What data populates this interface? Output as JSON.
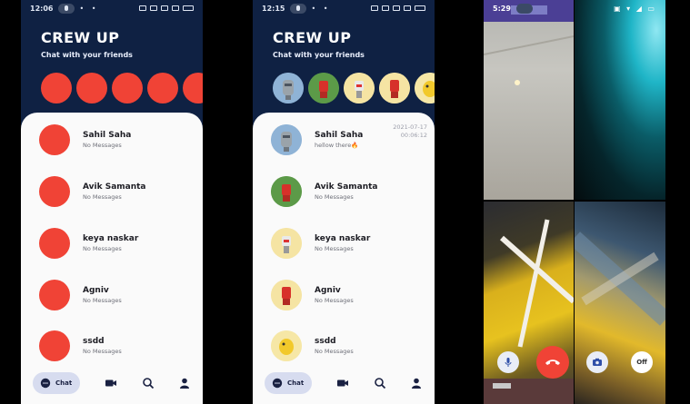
{
  "screens": [
    {
      "status_time": "12:06",
      "app_title": "CREW UP",
      "app_subtitle": "Chat with your friends",
      "chats": [
        {
          "name": "Sahil Saha",
          "message": "No Messages",
          "date": "",
          "time": ""
        },
        {
          "name": "Avik Samanta",
          "message": "No Messages",
          "date": "",
          "time": ""
        },
        {
          "name": "keya naskar",
          "message": "No Messages",
          "date": "",
          "time": ""
        },
        {
          "name": "Agniv",
          "message": "No Messages",
          "date": "",
          "time": ""
        },
        {
          "name": "ssdd",
          "message": "No Messages",
          "date": "",
          "time": ""
        }
      ],
      "nav": {
        "chat_label": "Chat"
      }
    },
    {
      "status_time": "12:15",
      "app_title": "CREW UP",
      "app_subtitle": "Chat with your friends",
      "chats": [
        {
          "name": "Sahil Saha",
          "message": "hellow there🔥",
          "date": "2021-07-17",
          "time": "00:06:12"
        },
        {
          "name": "Avik Samanta",
          "message": "No Messages",
          "date": "",
          "time": ""
        },
        {
          "name": "keya naskar",
          "message": "No Messages",
          "date": "",
          "time": ""
        },
        {
          "name": "Agniv",
          "message": "No Messages",
          "date": "",
          "time": ""
        },
        {
          "name": "ssdd",
          "message": "No Messages",
          "date": "",
          "time": ""
        }
      ],
      "nav": {
        "chat_label": "Chat"
      }
    }
  ],
  "call": {
    "status_time": "5:29",
    "off_label": "Off"
  },
  "colors": {
    "header_bg": "#0f2143",
    "avatar_placeholder": "#f04336",
    "end_call": "#f04336",
    "nav_pill": "#d7dcef"
  }
}
